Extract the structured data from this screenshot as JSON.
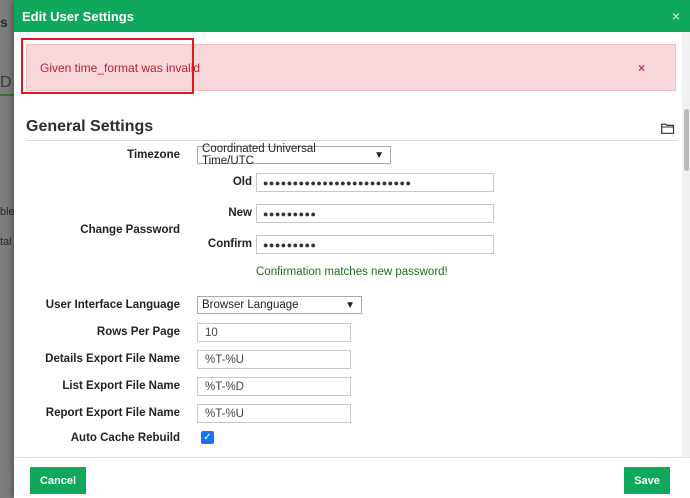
{
  "background": {
    "fragments": [
      "s",
      "D",
      "ble",
      "tal"
    ]
  },
  "modal": {
    "title": "Edit User Settings",
    "close_glyph": "×"
  },
  "alert": {
    "message": "Given time_format was invalid",
    "close_glyph": "×"
  },
  "section": {
    "title": "General Settings",
    "icon": "folder-icon"
  },
  "timezone": {
    "label": "Timezone",
    "value": "Coordinated Universal Time/UTC",
    "caret": "▼"
  },
  "change_password": {
    "label": "Change Password",
    "old_label": "Old",
    "old_value": "●●●●●●●●●●●●●●●●●●●●●●●●●",
    "new_label": "New",
    "new_value": "●●●●●●●●●",
    "confirm_label": "Confirm",
    "confirm_value": "●●●●●●●●●",
    "confirm_message": "Confirmation matches new password!"
  },
  "language": {
    "label": "User Interface Language",
    "value": "Browser Language",
    "caret": "▼"
  },
  "rows_per_page": {
    "label": "Rows Per Page",
    "value": "10"
  },
  "details_export": {
    "label": "Details Export File Name",
    "value": "%T-%U"
  },
  "list_export": {
    "label": "List Export File Name",
    "value": "%T-%D"
  },
  "report_export": {
    "label": "Report Export File Name",
    "value": "%T-%U"
  },
  "auto_cache": {
    "label": "Auto Cache Rebuild",
    "checked": true,
    "check_glyph": "✓"
  },
  "footer": {
    "cancel_label": "Cancel",
    "save_label": "Save"
  },
  "colors": {
    "header": "#10a85a",
    "alert_bg": "#f8d7da",
    "alert_text": "#b4232f",
    "highlight": "#e0191f",
    "confirm_text": "#1f6e1f"
  }
}
